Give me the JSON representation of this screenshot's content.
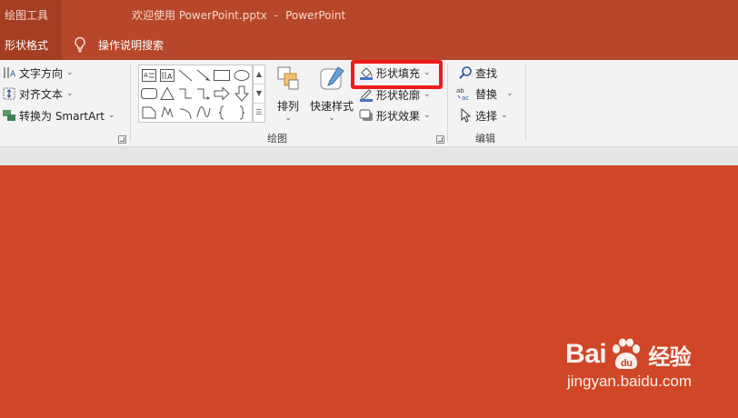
{
  "titlebar": {
    "context_tab_group": "绘图工具",
    "document": "欢迎使用 PowerPoint.pptx",
    "separator": "-",
    "app": "PowerPoint"
  },
  "tabs": {
    "shape_format": "形状格式",
    "tell_me": "操作说明搜索"
  },
  "ribbon": {
    "text_group": {
      "text_direction": "文字方向",
      "align_text": "对齐文本",
      "convert_smartart": "转换为 SmartArt"
    },
    "drawing_group": {
      "label": "绘图",
      "arrange": "排列",
      "quick_styles": "快速样式",
      "shape_fill": "形状填充",
      "shape_outline": "形状轮廓",
      "shape_effects": "形状效果"
    },
    "editing_group": {
      "label": "编辑",
      "find": "查找",
      "replace": "替换",
      "select": "选择"
    }
  },
  "colors": {
    "title_bar": "#b7472a",
    "slide_background": "#d04727",
    "highlight_box": "#ee1b1b"
  },
  "watermark": {
    "brand_left": "Bai",
    "brand_right": "du",
    "suffix": "经验",
    "url": "jingyan.baidu.com"
  }
}
